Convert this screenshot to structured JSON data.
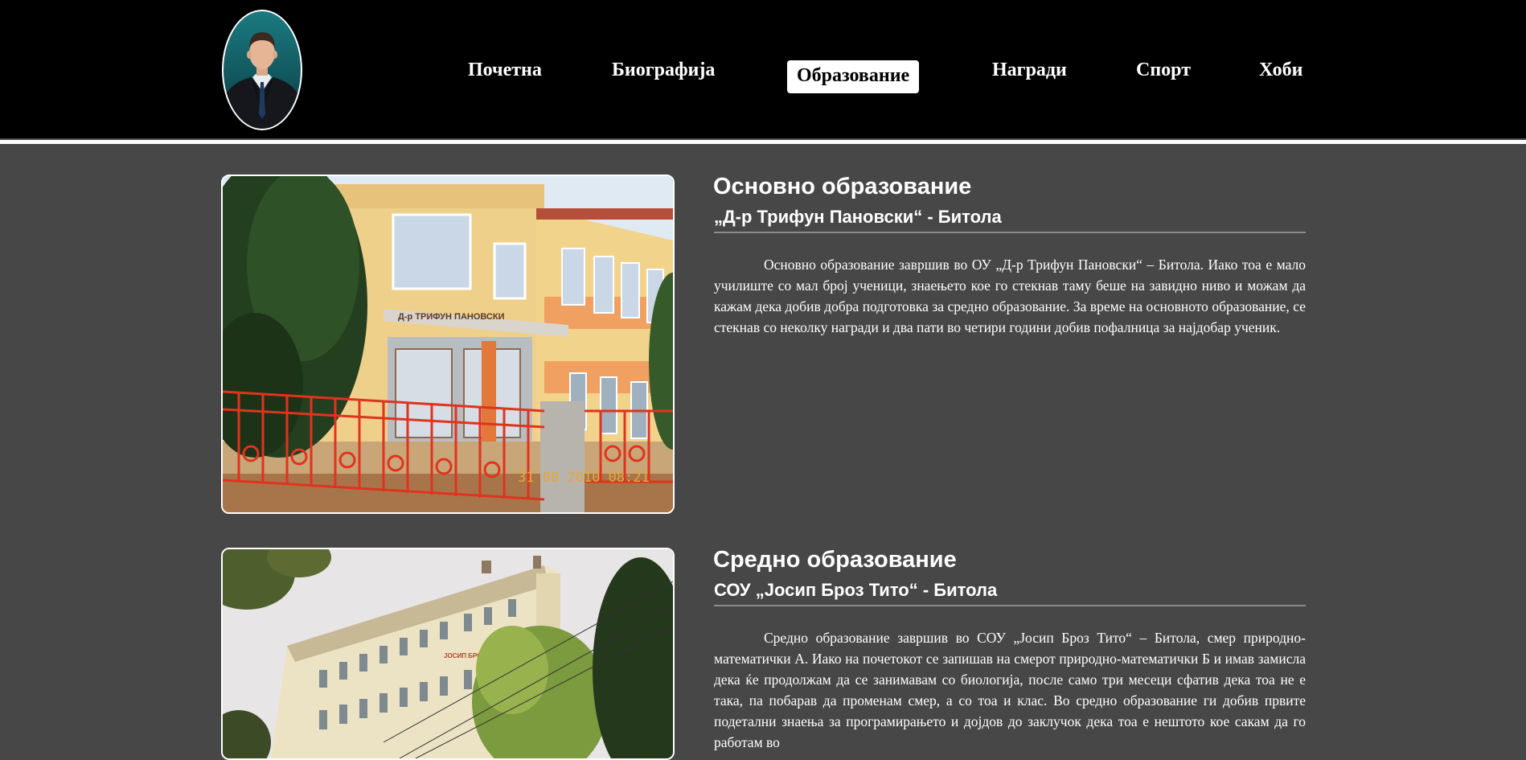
{
  "header": {
    "avatar_alt": "profile photo"
  },
  "nav": {
    "items": [
      {
        "label": "Почетна"
      },
      {
        "label": "Биографија"
      },
      {
        "label": "Образование"
      },
      {
        "label": "Награди"
      },
      {
        "label": "Спорт"
      },
      {
        "label": "Хоби"
      }
    ],
    "active": "Образование"
  },
  "sections": [
    {
      "title": "Основно образование",
      "subtitle": "„Д-р Трифун Пановски“ - Битола",
      "text": "Основно образование завршив во ОУ „Д-р Трифун Пановски“ – Битола. Иако тоа е мало училиште со мал број ученици, знаењето кое го стекнав таму беше на завидно ниво и можам да кажам дека добив добра подготовка за средно образование. За време на основното образование, се стекнав со неколку награди и два пати во четири години добив пофалница за најдобар ученик.",
      "photo": {
        "school_sign": "Д-р ТРИФУН ПАНОВСКИ",
        "timestamp": "31 08 2010 08:21"
      }
    },
    {
      "title": "Средно образование",
      "subtitle": "СОУ „Јосип Броз Тито“ - Битола",
      "text": "Средно образование завршив во СОУ „Јосип Броз Тито“ – Битола, смер природно-математички А. Иако на почетокот се запишав на смерот природно-математички Б и имав замисла дека ќе продолжам да се занимавам со биологија, после само три месеци сфатив дека тоа не е така, па побарав да променам смер, а со тоа и клас. Во средно образование ги добив првите подетални знаења за програмирањето и дојдов до заклучок дека тоа е нештото кое сакам да го работам во",
      "photo": {
        "school_sign": "ЈОСИП БРОЗ ТИТО"
      }
    }
  ],
  "colors": {
    "header_bg": "#000000",
    "page_bg": "#474747",
    "divider": "#8c8c8c",
    "active_nav_bg": "#ffffff"
  }
}
